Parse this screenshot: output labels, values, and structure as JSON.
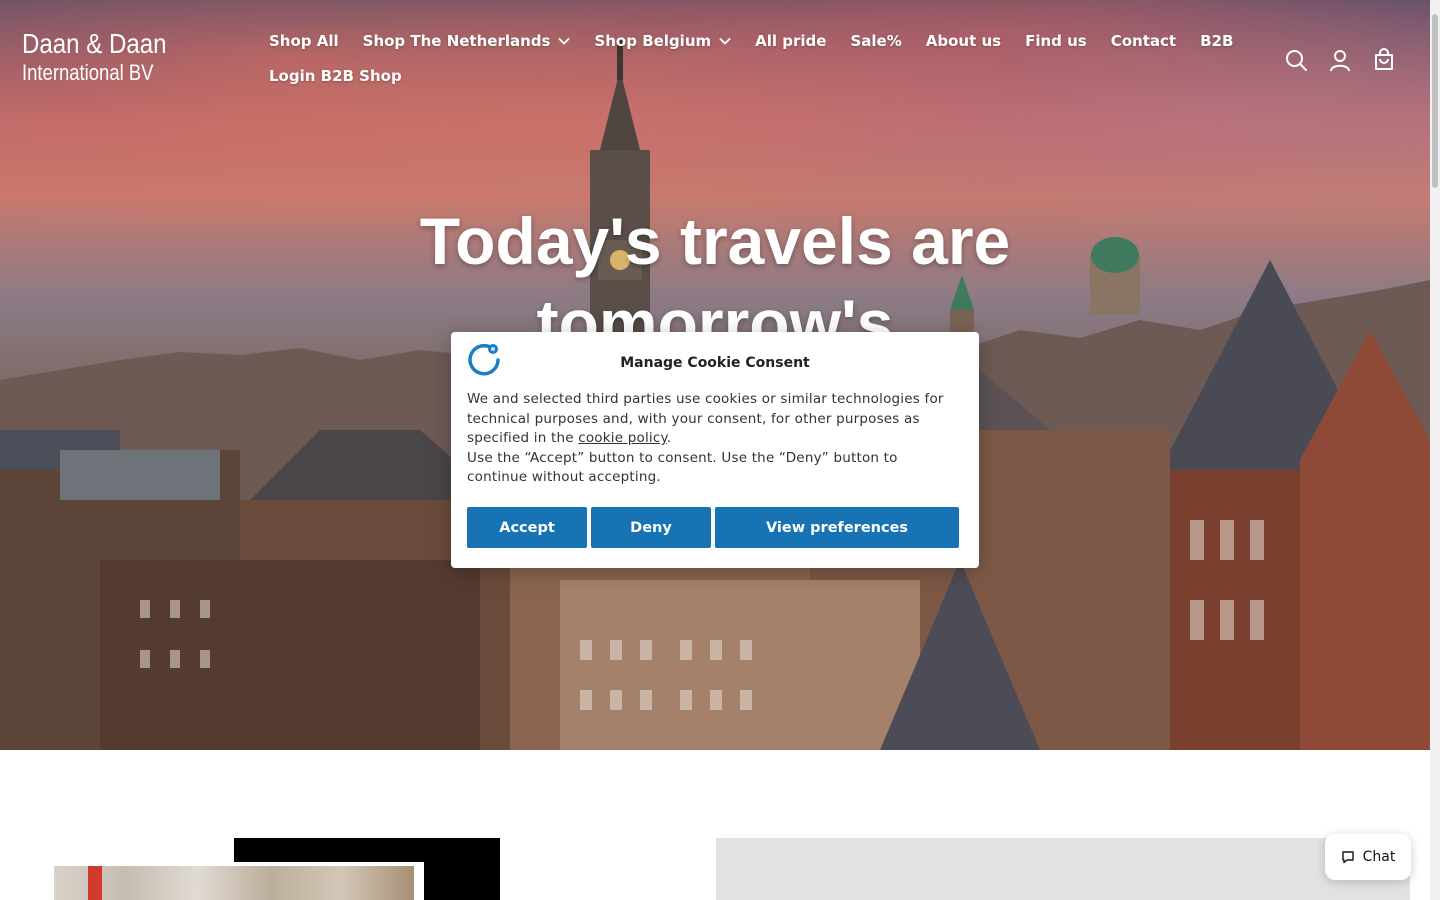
{
  "brand": {
    "line1": "Daan & Daan",
    "line2": "International BV"
  },
  "nav": {
    "row1": [
      {
        "label": "Shop All",
        "dropdown": false
      },
      {
        "label": "Shop The Netherlands",
        "dropdown": true
      },
      {
        "label": "Shop Belgium",
        "dropdown": true
      },
      {
        "label": "All pride",
        "dropdown": false
      },
      {
        "label": "Sale%",
        "dropdown": false
      },
      {
        "label": "About us",
        "dropdown": false
      },
      {
        "label": "Find us",
        "dropdown": false
      },
      {
        "label": "Contact",
        "dropdown": false
      },
      {
        "label": "B2B",
        "dropdown": false
      }
    ],
    "row2": [
      {
        "label": "Login B2B Shop",
        "dropdown": false
      }
    ]
  },
  "header_icons": [
    "search-icon",
    "account-icon",
    "cart-icon"
  ],
  "hero": {
    "headline_line1": "Today's travels are",
    "headline_line2": "tomorrow's"
  },
  "cookie": {
    "title": "Manage Cookie Consent",
    "text_before_link": "We and selected third parties use cookies or similar technologies for technical purposes and, with your consent, for other purposes as specified in the",
    "link_text": "cookie policy",
    "text_after_link": ".",
    "text2": "Use the “Accept” button to consent. Use the “Deny” button to continue without accepting.",
    "accept_label": "Accept",
    "deny_label": "Deny",
    "prefs_label": "View preferences",
    "button_color": "#1773b3"
  },
  "chat": {
    "label": "Chat"
  }
}
